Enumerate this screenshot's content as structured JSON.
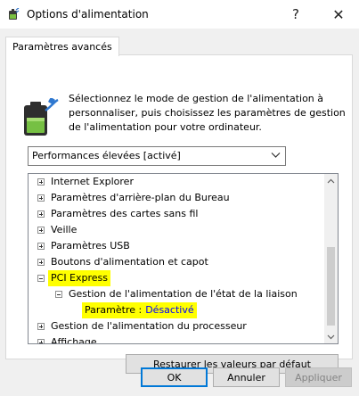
{
  "window": {
    "title": "Options d'alimentation",
    "help_glyph": "?",
    "close_glyph": "✕"
  },
  "tab": {
    "label": "Paramètres avancés"
  },
  "description": "Sélectionnez le mode de gestion de l'alimentation à personnaliser, puis choisissez les paramètres de gestion de l'alimentation pour votre ordinateur.",
  "plan_select": {
    "selected": "Performances élevées [activé]"
  },
  "tree": {
    "items": [
      {
        "label": "Internet Explorer",
        "state": "collapsed"
      },
      {
        "label": "Paramètres d'arrière-plan du Bureau",
        "state": "collapsed"
      },
      {
        "label": "Paramètres des cartes sans fil",
        "state": "collapsed"
      },
      {
        "label": "Veille",
        "state": "collapsed"
      },
      {
        "label": "Paramètres USB",
        "state": "collapsed"
      },
      {
        "label": "Boutons d'alimentation et capot",
        "state": "collapsed"
      },
      {
        "label": "PCI Express",
        "state": "expanded"
      },
      {
        "label": "Gestion de l'alimentation de l'état de la liaison",
        "state": "expanded"
      },
      {
        "label": "Paramètre :",
        "value": "Désactivé"
      },
      {
        "label": "Gestion de l'alimentation du processeur",
        "state": "collapsed"
      },
      {
        "label": "Affichage",
        "state": "collapsed"
      }
    ]
  },
  "buttons": {
    "restore": "Restaurer les valeurs par défaut",
    "ok": "OK",
    "cancel": "Annuler",
    "apply": "Appliquer"
  },
  "colors": {
    "highlight": "#ffff00",
    "value_text": "#0000ff",
    "default_button_border": "#0078d7"
  }
}
